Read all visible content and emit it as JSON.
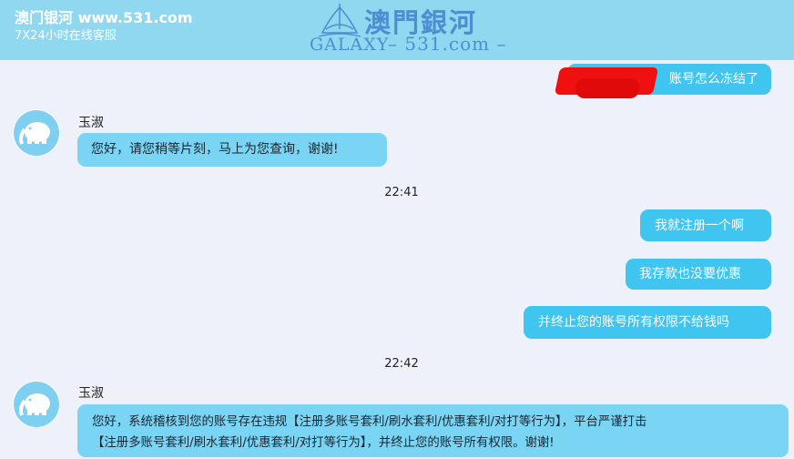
{
  "header": {
    "site_name": "澳门银河 www.531.com",
    "service_hours": "7X24小时在线客服",
    "logo": {
      "chinese_name": "澳門銀河",
      "english_name": "GALAXY",
      "domain": "– 531.com –"
    }
  },
  "colors": {
    "header_bg": "#8fd8ef",
    "user_bubble": "#40c4f0",
    "agent_bubble": "#7ad4f4",
    "page_bg": "#eef1f9"
  },
  "agent": {
    "name": "玉淑",
    "avatar_icon": "elephant-icon"
  },
  "messages": [
    {
      "from": "user",
      "text": "账号怎么冻结了"
    },
    {
      "from": "agent",
      "name": "玉淑",
      "text": "您好，请您稍等片刻，马上为您查询，谢谢!"
    },
    {
      "type": "time",
      "text": "22:41"
    },
    {
      "from": "user",
      "text": "我就注册一个啊"
    },
    {
      "from": "user",
      "text": "我存款也没要优惠"
    },
    {
      "from": "user",
      "text": "并终止您的账号所有权限不给钱吗"
    },
    {
      "type": "time",
      "text": "22:42"
    },
    {
      "from": "agent",
      "name": "玉淑",
      "lines": [
        "您好，系统稽核到您的账号存在违规【注册多账号套利/刷水套利/优惠套利/对打等行为】，平台严谨打击",
        "【注册多账号套利/刷水套利/优惠套利/对打等行为】，并终止您的账号所有权限。谢谢!"
      ]
    }
  ]
}
